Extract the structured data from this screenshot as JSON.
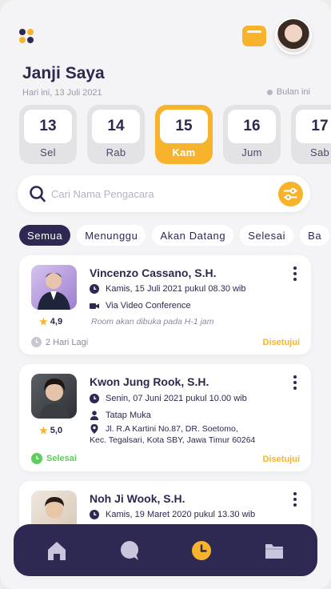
{
  "header": {
    "title": "Janji Saya",
    "date_text": "Hari ini, 13 Juli 2021",
    "month_filter": "Bulan ini",
    "icons": [
      "menu-icon",
      "wallet-icon",
      "avatar"
    ]
  },
  "days": [
    {
      "num": "13",
      "name": "Sel",
      "active": false
    },
    {
      "num": "14",
      "name": "Rab",
      "active": false
    },
    {
      "num": "15",
      "name": "Kam",
      "active": true
    },
    {
      "num": "16",
      "name": "Jum",
      "active": false
    },
    {
      "num": "17",
      "name": "Sab",
      "active": false
    }
  ],
  "search": {
    "placeholder": "Cari Nama Pengacara"
  },
  "tabs": [
    {
      "label": "Semua",
      "active": true
    },
    {
      "label": "Menunggu",
      "active": false
    },
    {
      "label": "Akan Datang",
      "active": false
    },
    {
      "label": "Selesai",
      "active": false
    },
    {
      "label": "Ba",
      "active": false
    }
  ],
  "appointments": [
    {
      "name": "Vincenzo Cassano, S.H.",
      "rating": "4,9",
      "schedule": "Kamis, 15 Juli 2021 pukul 08.30 wib",
      "mode": "Via Video Conference",
      "note": "Room akan dibuka pada H-1 jam",
      "meta": "2 Hari Lagi",
      "status": "Disetujui"
    },
    {
      "name": "Kwon Jung Rook, S.H.",
      "rating": "5,0",
      "schedule": "Senin, 07 Juni 2021 pukul 10.00 wib",
      "mode": "Tatap Muka",
      "address_line1": "Jl. R.A Kartini No.87, DR. Soetomo,",
      "address_line2": "Kec. Tegalsari, Kota SBY, Jawa Timur 60264",
      "meta": "Selesai",
      "status": "Disetujui"
    },
    {
      "name": "Noh Ji Wook, S.H.",
      "schedule": "Kamis, 19 Maret 2020 pukul 13.30 wib"
    }
  ],
  "colors": {
    "accent": "#f7b32b",
    "navy": "#2e2952",
    "success": "#5ccf5a",
    "muted": "#9a98a8"
  },
  "nav": [
    "home-icon",
    "chat-icon",
    "clock-icon",
    "folder-icon"
  ]
}
